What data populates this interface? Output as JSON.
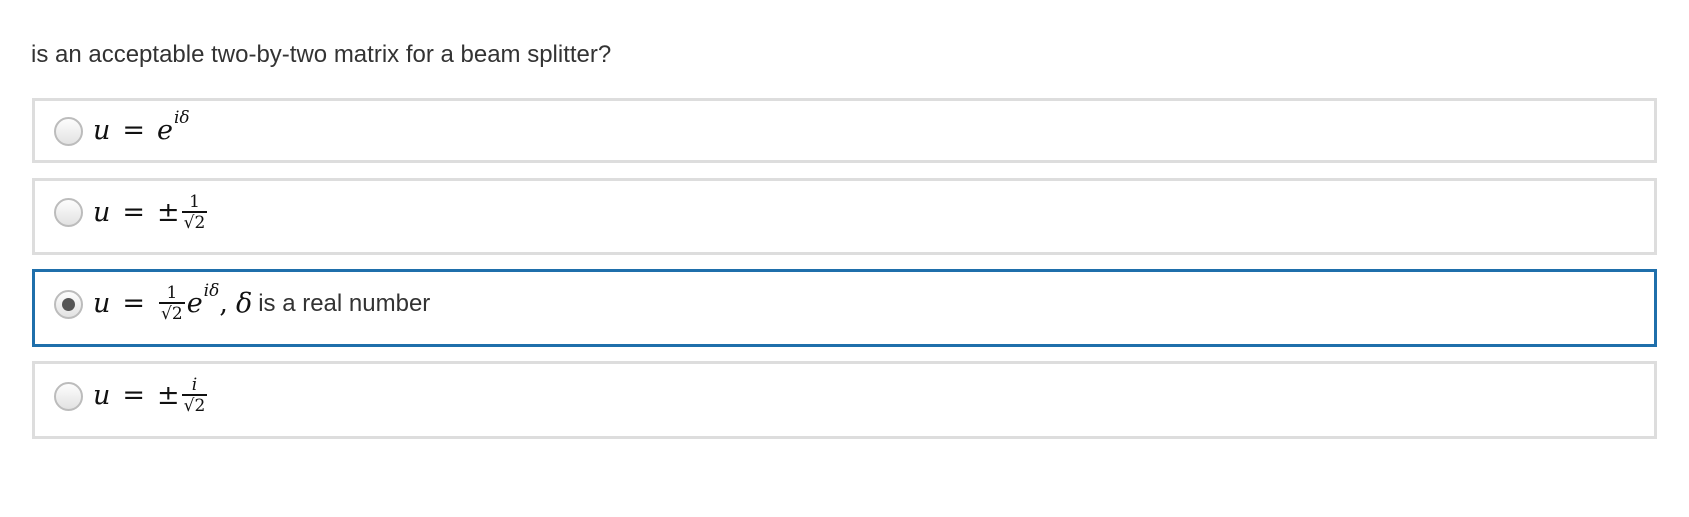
{
  "question": {
    "text": "is an acceptable two-by-two matrix for a beam splitter?"
  },
  "choices": [
    {
      "selected": false,
      "var": "u",
      "eq": "=",
      "base": "e",
      "exponent": "iδ"
    },
    {
      "selected": false,
      "var": "u",
      "eq": "=",
      "sign": "±",
      "numerator": "1",
      "radical": "√",
      "radicand": "2"
    },
    {
      "selected": true,
      "var": "u",
      "eq": "=",
      "numerator": "1",
      "radical": "√",
      "radicand": "2",
      "base": "e",
      "exponent": "iδ",
      "separator": ",",
      "symbol": "δ",
      "text": "is a real number"
    },
    {
      "selected": false,
      "var": "u",
      "eq": "=",
      "sign": "±",
      "numerator": "i",
      "radical": "√",
      "radicand": "2"
    }
  ],
  "colors": {
    "selected_border": "#1f6fab",
    "default_border": "#dddddd",
    "text": "#333333"
  }
}
